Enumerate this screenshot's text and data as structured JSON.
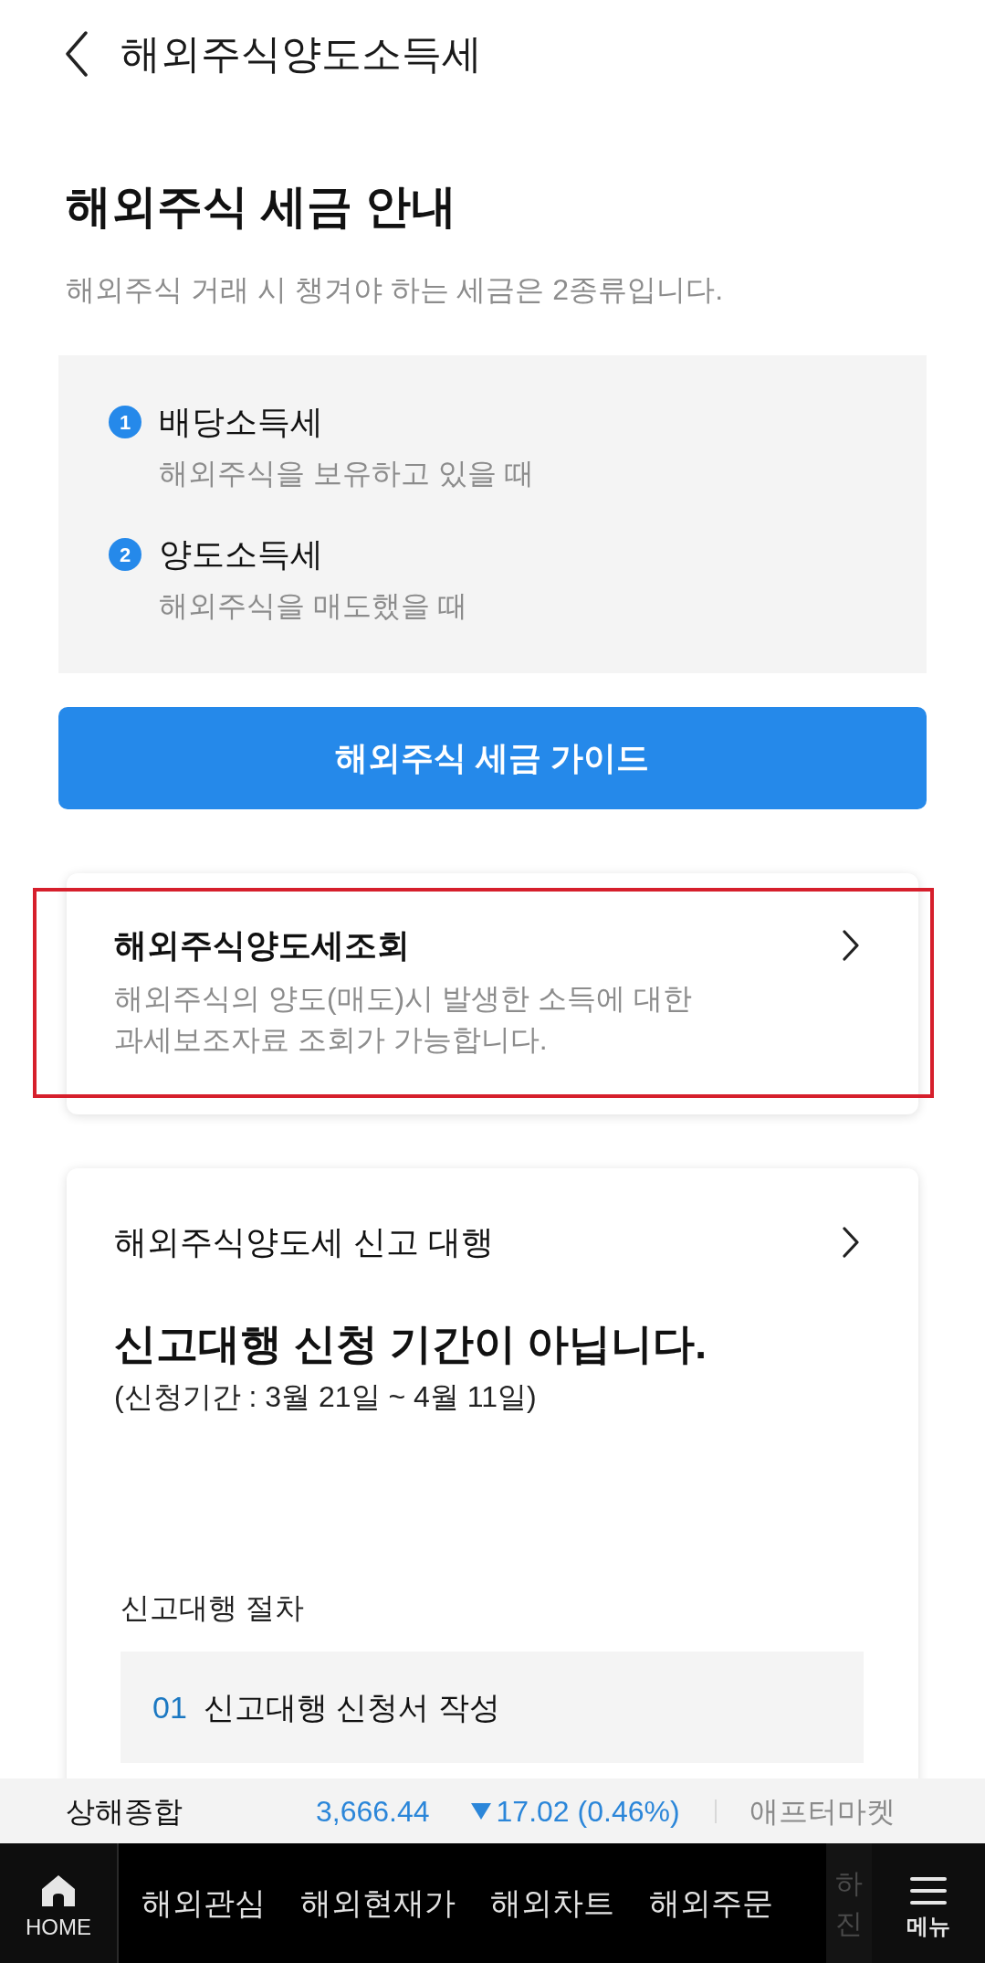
{
  "header": {
    "title": "해외주식양도소득세"
  },
  "intro": {
    "heading": "해외주식 세금 안내",
    "subtitle": "해외주식 거래 시 챙겨야 하는 세금은 2종류입니다."
  },
  "tax_types": [
    {
      "number": "1",
      "name": "배당소득세",
      "description": "해외주식을 보유하고 있을 때"
    },
    {
      "number": "2",
      "name": "양도소득세",
      "description": "해외주식을 매도했을 때"
    }
  ],
  "guide_button": {
    "label": "해외주식 세금 가이드"
  },
  "cards": [
    {
      "kind": "lookup",
      "title": "해외주식양도세조회",
      "description": "해외주식의 양도(매도)시 발생한 소득에 대한 과세보조자료 조회가 가능합니다.",
      "highlighted": true
    },
    {
      "kind": "filing",
      "title": "해외주식양도세 신고 대행",
      "notice": "신고대행 신청 기간이 아닙니다.",
      "period": "(신청기간 : 3월 21일 ~ 4월 11일)",
      "steps_title": "신고대행 절차",
      "steps": [
        {
          "number": "01",
          "label": "신고대행 신청서 작성"
        }
      ],
      "highlighted": false
    }
  ],
  "ticker": {
    "index_name": "상해종합",
    "price": "3,666.44",
    "falling": true,
    "change": "17.02 (0.46%)",
    "session": "애프터마켓"
  },
  "bottom_nav": {
    "home_label": "HOME",
    "items": [
      {
        "label": "해외관심",
        "selected": false
      },
      {
        "label": "해외현재가",
        "selected": false
      },
      {
        "label": "해외차트",
        "selected": false
      },
      {
        "label": "해외주문",
        "selected": false
      }
    ],
    "peek_item": {
      "lines": [
        "하",
        "진"
      ]
    },
    "menu_label": "메뉴"
  }
}
